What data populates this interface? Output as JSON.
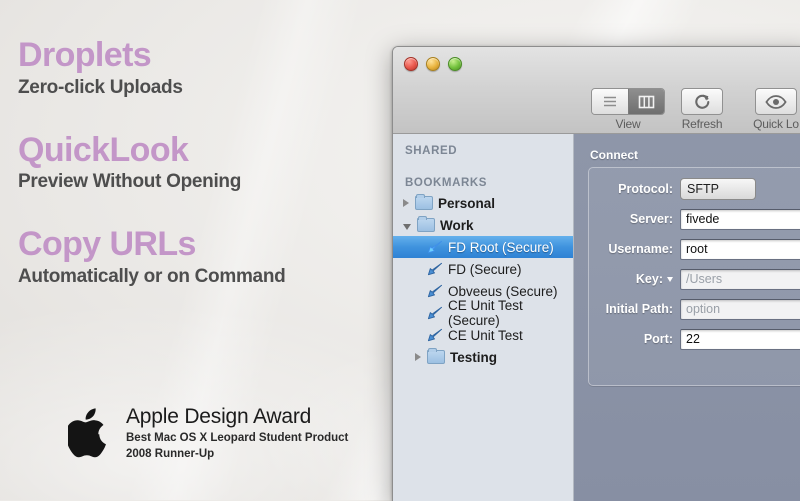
{
  "promo": {
    "blocks": [
      {
        "heading": "Droplets",
        "sub": "Zero-click Uploads"
      },
      {
        "heading": "QuickLook",
        "sub": "Preview Without Opening"
      },
      {
        "heading": "Copy URLs",
        "sub": "Automatically or on Command"
      }
    ],
    "heading_color": "#c396c8",
    "sub_color": "#4e4e4e"
  },
  "award": {
    "logo": "apple-logo",
    "title": "Apple Design Award",
    "line1": "Best Mac OS X Leopard Student Product",
    "line2": "2008 Runner-Up"
  },
  "window": {
    "controls": {
      "close": "close-button",
      "minimize": "minimize-button",
      "zoom": "zoom-button"
    },
    "toolbar": [
      {
        "name": "view",
        "label": "View",
        "icon": "segmented-view-control",
        "segments": [
          {
            "icon": "list-view-icon",
            "selected": false
          },
          {
            "icon": "column-view-icon",
            "selected": true
          }
        ]
      },
      {
        "name": "refresh",
        "label": "Refresh",
        "icon": "refresh-icon"
      },
      {
        "name": "quick-look",
        "label": "Quick Lo",
        "icon": "eye-icon"
      }
    ]
  },
  "sidebar": {
    "sections": [
      {
        "header": "SHARED",
        "rows": []
      },
      {
        "header": "BOOKMARKS",
        "rows": [
          {
            "label": "Personal",
            "type": "folder",
            "disclosure": "right",
            "icon": "folder-icon",
            "selected": false
          },
          {
            "label": "Work",
            "type": "folder",
            "disclosure": "down",
            "icon": "folder-icon",
            "selected": false
          },
          {
            "label": "FD Root (Secure)",
            "type": "bookmark",
            "disclosure": "none",
            "icon": "bookmark-bolt-icon",
            "selected": true
          },
          {
            "label": "FD (Secure)",
            "type": "bookmark",
            "disclosure": "none",
            "icon": "bookmark-bolt-icon",
            "selected": false
          },
          {
            "label": "Obveeus (Secure)",
            "type": "bookmark",
            "disclosure": "none",
            "icon": "bookmark-bolt-icon",
            "selected": false
          },
          {
            "label": "CE Unit Test (Secure)",
            "type": "bookmark",
            "disclosure": "none",
            "icon": "bookmark-bolt-icon",
            "selected": false
          },
          {
            "label": "CE Unit Test",
            "type": "bookmark",
            "disclosure": "none",
            "icon": "bookmark-bolt-icon",
            "selected": false
          },
          {
            "label": "Testing",
            "type": "folder",
            "disclosure": "right",
            "icon": "folder-icon",
            "selected": false
          }
        ]
      }
    ]
  },
  "connect": {
    "title": "Connect",
    "fields": [
      {
        "label": "Protocol:",
        "kind": "popup",
        "value": "SFTP",
        "placeholder": ""
      },
      {
        "label": "Server:",
        "kind": "text",
        "value": "fivede",
        "placeholder": ""
      },
      {
        "label": "Username:",
        "kind": "text",
        "value": "root",
        "placeholder": ""
      },
      {
        "label": "Key:",
        "kind": "text",
        "value": "",
        "placeholder": "/Users",
        "dropdown": true
      },
      {
        "label": "Initial Path:",
        "kind": "text",
        "value": "",
        "placeholder": "option"
      },
      {
        "label": "Port:",
        "kind": "text",
        "value": "22",
        "placeholder": ""
      }
    ]
  },
  "colors": {
    "accent_purple": "#c396c8",
    "selection_blue": "#3f93de",
    "sidebar_bg": "#dde2e9",
    "panel_bg": "#8d95a8"
  }
}
